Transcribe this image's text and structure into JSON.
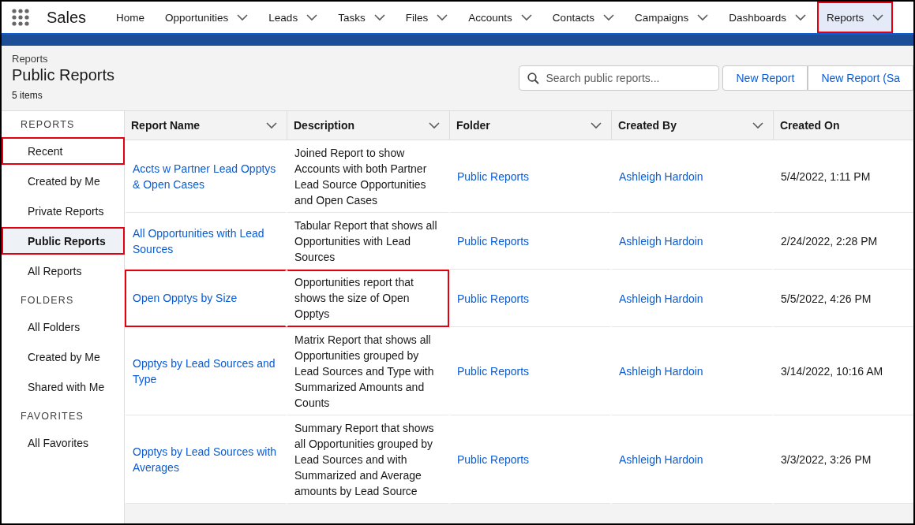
{
  "app": {
    "name": "Sales"
  },
  "nav": [
    {
      "label": "Home",
      "has_menu": false,
      "selected": false,
      "highlighted": false
    },
    {
      "label": "Opportunities",
      "has_menu": true,
      "selected": false,
      "highlighted": false
    },
    {
      "label": "Leads",
      "has_menu": true,
      "selected": false,
      "highlighted": false
    },
    {
      "label": "Tasks",
      "has_menu": true,
      "selected": false,
      "highlighted": false
    },
    {
      "label": "Files",
      "has_menu": true,
      "selected": false,
      "highlighted": false
    },
    {
      "label": "Accounts",
      "has_menu": true,
      "selected": false,
      "highlighted": false
    },
    {
      "label": "Contacts",
      "has_menu": true,
      "selected": false,
      "highlighted": false
    },
    {
      "label": "Campaigns",
      "has_menu": true,
      "selected": false,
      "highlighted": false
    },
    {
      "label": "Dashboards",
      "has_menu": true,
      "selected": false,
      "highlighted": false
    },
    {
      "label": "Reports",
      "has_menu": true,
      "selected": true,
      "highlighted": true
    }
  ],
  "header": {
    "breadcrumb": "Reports",
    "title": "Public Reports",
    "count": "5 items",
    "search": {
      "placeholder": "Search public reports..."
    },
    "buttons": [
      "New Report",
      "New Report (Sa"
    ]
  },
  "sidebar": [
    {
      "heading": "REPORTS",
      "items": [
        {
          "label": "Recent",
          "selected": false,
          "highlighted": true
        },
        {
          "label": "Created by Me",
          "selected": false,
          "highlighted": false
        },
        {
          "label": "Private Reports",
          "selected": false,
          "highlighted": false
        },
        {
          "label": "Public Reports",
          "selected": true,
          "highlighted": true
        },
        {
          "label": "All Reports",
          "selected": false,
          "highlighted": false
        }
      ]
    },
    {
      "heading": "FOLDERS",
      "items": [
        {
          "label": "All Folders",
          "selected": false,
          "highlighted": false
        },
        {
          "label": "Created by Me",
          "selected": false,
          "highlighted": false
        },
        {
          "label": "Shared with Me",
          "selected": false,
          "highlighted": false
        }
      ]
    },
    {
      "heading": "FAVORITES",
      "items": [
        {
          "label": "All Favorites",
          "selected": false,
          "highlighted": false
        }
      ]
    }
  ],
  "table": {
    "columns": [
      {
        "label": "Report Name",
        "has_menu": true
      },
      {
        "label": "Description",
        "has_menu": true
      },
      {
        "label": "Folder",
        "has_menu": true
      },
      {
        "label": "Created By",
        "has_menu": true
      },
      {
        "label": "Created On",
        "has_menu": false
      }
    ],
    "rows": [
      {
        "name": "Accts w Partner Lead Opptys & Open Cases",
        "description": "Joined Report to show Accounts with both Partner Lead Source Opportunities and Open Cases",
        "folder": "Public Reports",
        "created_by": "Ashleigh Hardoin",
        "created_on": "5/4/2022, 1:11 PM",
        "highlighted": false
      },
      {
        "name": "All Opportunities with Lead Sources",
        "description": "Tabular Report that shows all Opportunities with Lead Sources",
        "folder": "Public Reports",
        "created_by": "Ashleigh Hardoin",
        "created_on": "2/24/2022, 2:28 PM",
        "highlighted": false
      },
      {
        "name": "Open Opptys by Size",
        "description": "Opportunities report that shows the size of Open Opptys",
        "folder": "Public Reports",
        "created_by": "Ashleigh Hardoin",
        "created_on": "5/5/2022, 4:26 PM",
        "highlighted": true
      },
      {
        "name": "Opptys by Lead Sources and Type",
        "description": "Matrix Report that shows all Opportunities grouped by Lead Sources and Type with Summarized Amounts and Counts",
        "folder": "Public Reports",
        "created_by": "Ashleigh Hardoin",
        "created_on": "3/14/2022, 10:16 AM",
        "highlighted": false
      },
      {
        "name": "Opptys by Lead Sources with Averages",
        "description": "Summary Report that shows all Opportunities grouped by Lead Sources and with Summarized and Average amounts by Lead Source",
        "folder": "Public Reports",
        "created_by": "Ashleigh Hardoin",
        "created_on": "3/3/2022, 3:26 PM",
        "highlighted": false
      }
    ]
  }
}
